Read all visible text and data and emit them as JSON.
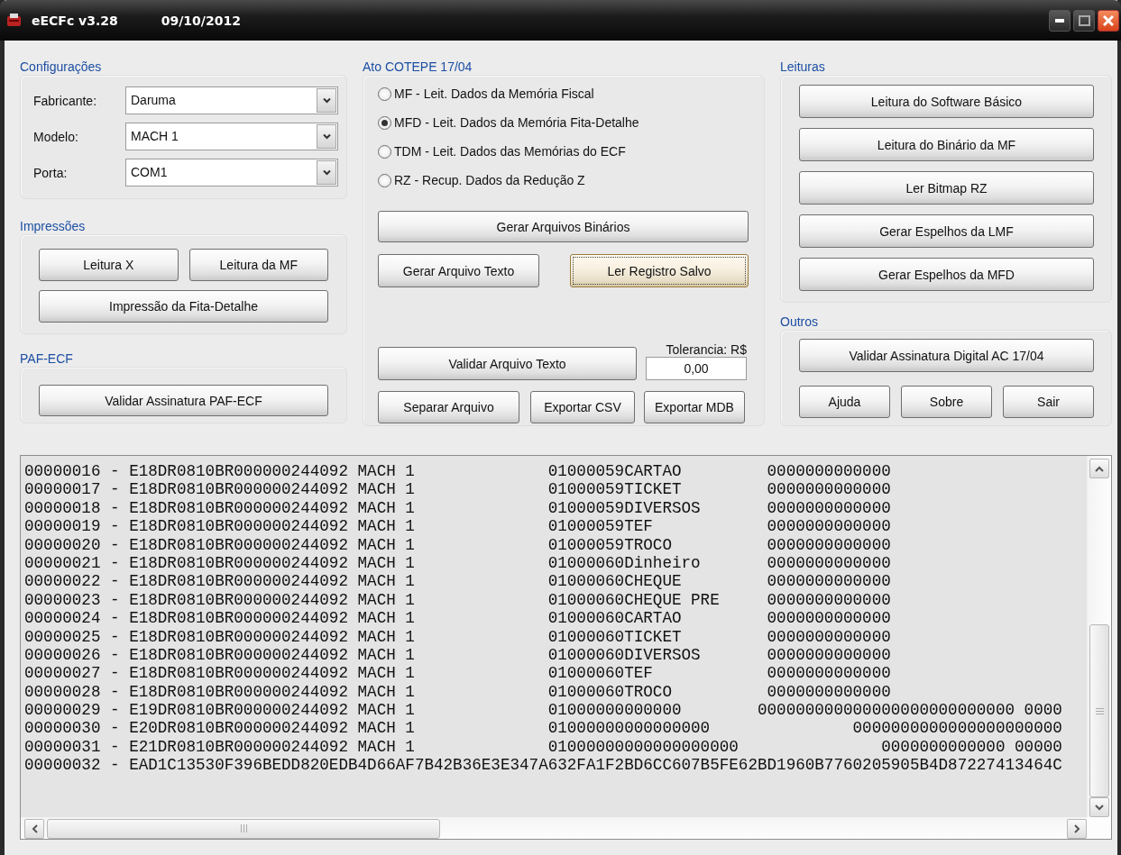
{
  "window": {
    "title": "eECFc v3.28",
    "date": "09/10/2012"
  },
  "configuracoes": {
    "title": "Configurações",
    "fields": [
      {
        "label": "Fabricante:",
        "value": "Daruma"
      },
      {
        "label": "Modelo:",
        "value": "MACH 1"
      },
      {
        "label": "Porta:",
        "value": "COM1"
      }
    ]
  },
  "impressoes": {
    "title": "Impressões",
    "buttons": [
      "Leitura X",
      "Leitura da MF",
      "Impressão da Fita-Detalhe"
    ]
  },
  "paf_ecf": {
    "title": "PAF-ECF",
    "buttons": [
      "Validar Assinatura PAF-ECF"
    ]
  },
  "ato_cotepe": {
    "title": "Ato COTEPE 17/04",
    "options": [
      {
        "label": "MF - Leit. Dados da Memória Fiscal",
        "selected": false
      },
      {
        "label": "MFD - Leit. Dados da Memória Fita-Detalhe",
        "selected": true
      },
      {
        "label": "TDM - Leit. Dados das Memórias do ECF",
        "selected": false
      },
      {
        "label": "RZ - Recup. Dados da Redução Z",
        "selected": false
      }
    ],
    "buttons": [
      {
        "label": "Gerar Arquivos Binários",
        "focused": false
      },
      {
        "label": "Gerar Arquivo Texto",
        "focused": false
      },
      {
        "label": "Ler Registro Salvo",
        "focused": true
      },
      {
        "label": "Validar Arquivo Texto",
        "focused": false
      },
      {
        "label": "Separar Arquivo",
        "focused": false
      },
      {
        "label": "Exportar CSV",
        "focused": false
      },
      {
        "label": "Exportar MDB",
        "focused": false
      }
    ],
    "tolerance": {
      "label": "Tolerancia: R$",
      "value": "0,00"
    }
  },
  "leituras": {
    "title": "Leituras",
    "buttons": [
      "Leitura do Software Básico",
      "Leitura do Binário da MF",
      "Ler Bitmap RZ",
      "Gerar Espelhos da LMF",
      "Gerar Espelhos da MFD"
    ]
  },
  "outros": {
    "title": "Outros",
    "buttons": [
      "Validar Assinatura Digital AC 17/04",
      "Ajuda",
      "Sobre",
      "Sair"
    ]
  },
  "log": {
    "lines": [
      "00000016 - E18DR0810BR000000244092 MACH 1              01000059CARTAO         0000000000000",
      "00000017 - E18DR0810BR000000244092 MACH 1              01000059TICKET         0000000000000",
      "00000018 - E18DR0810BR000000244092 MACH 1              01000059DIVERSOS       0000000000000",
      "00000019 - E18DR0810BR000000244092 MACH 1              01000059TEF            0000000000000",
      "00000020 - E18DR0810BR000000244092 MACH 1              01000059TROCO          0000000000000",
      "00000021 - E18DR0810BR000000244092 MACH 1              01000060Dinheiro       0000000000000",
      "00000022 - E18DR0810BR000000244092 MACH 1              01000060CHEQUE         0000000000000",
      "00000023 - E18DR0810BR000000244092 MACH 1              01000060CHEQUE PRE     0000000000000",
      "00000024 - E18DR0810BR000000244092 MACH 1              01000060CARTAO         0000000000000",
      "00000025 - E18DR0810BR000000244092 MACH 1              01000060TICKET         0000000000000",
      "00000026 - E18DR0810BR000000244092 MACH 1              01000060DIVERSOS       0000000000000",
      "00000027 - E18DR0810BR000000244092 MACH 1              01000060TEF            0000000000000",
      "00000028 - E18DR0810BR000000244092 MACH 1              01000060TROCO          0000000000000",
      "00000029 - E19DR0810BR000000244092 MACH 1              01000000000000        000000000000000000000000000 0000",
      "00000030 - E20DR0810BR000000244092 MACH 1              01000000000000000               0000000000000000000000",
      "00000031 - E21DR0810BR000000244092 MACH 1              01000000000000000000               0000000000000 00000",
      "00000032 - EAD1C13530F396BEDD820EDB4D66AF7B42B36E3E347A632FA1F2BD6CC607B5FE62BD1960B7760205905B4D87227413464C"
    ]
  }
}
